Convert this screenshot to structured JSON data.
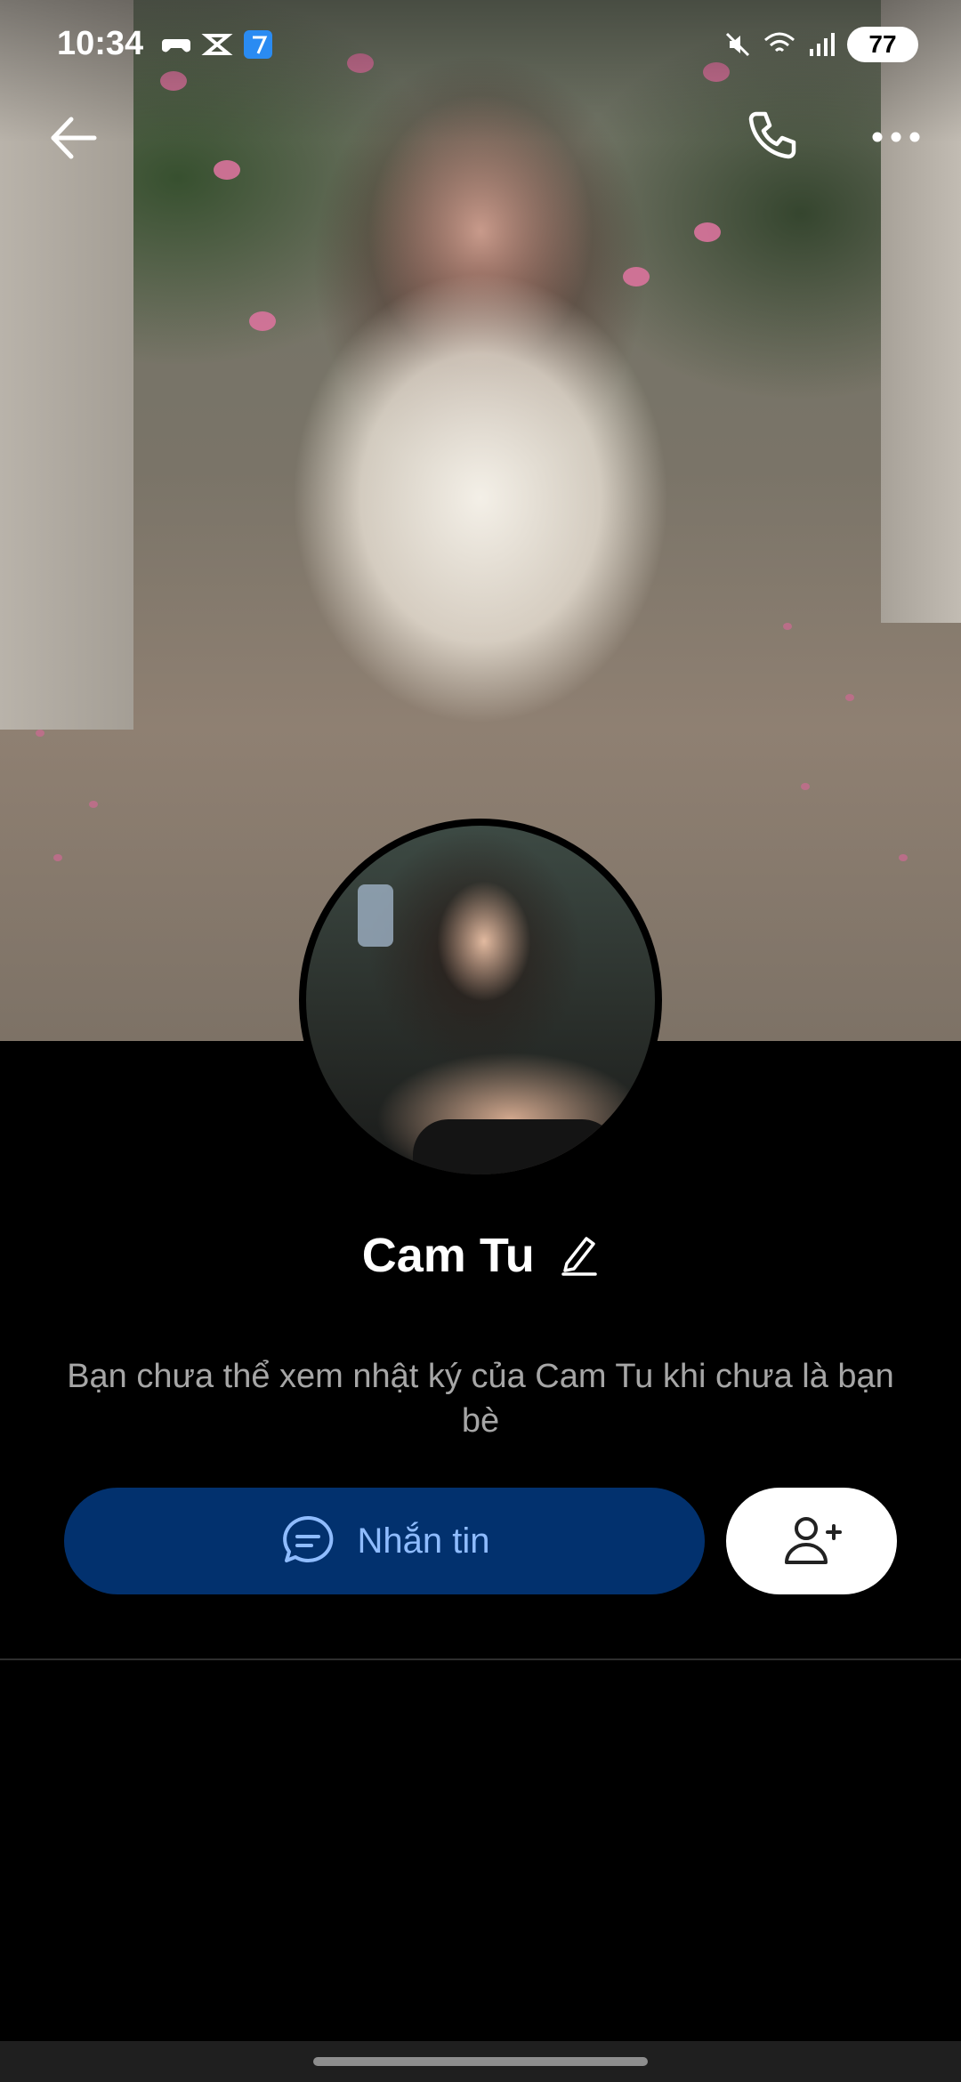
{
  "status_bar": {
    "time": "10:34",
    "battery": "77",
    "app_icons": [
      "game-controller-icon",
      "capcut-icon",
      "messenger-app-icon"
    ],
    "system_icons": [
      "mute-icon",
      "wifi-icon",
      "signal-icon"
    ]
  },
  "top_bar": {
    "back_icon": "arrow-left-icon",
    "call_icon": "phone-icon",
    "more_icon": "more-horizontal-icon"
  },
  "profile": {
    "name": "Cam Tu",
    "edit_icon": "pencil-icon",
    "notice": "Bạn chưa thể xem nhật ký của Cam Tu khi chưa là bạn bè"
  },
  "actions": {
    "message_label": "Nhắn tin",
    "message_icon": "chat-bubble-icon",
    "add_friend_icon": "add-user-icon"
  },
  "colors": {
    "background": "#000000",
    "message_button": "#02316e",
    "message_text": "#8fbcff",
    "add_friend_button": "#ffffff",
    "notice_text": "#a6a6a6"
  }
}
